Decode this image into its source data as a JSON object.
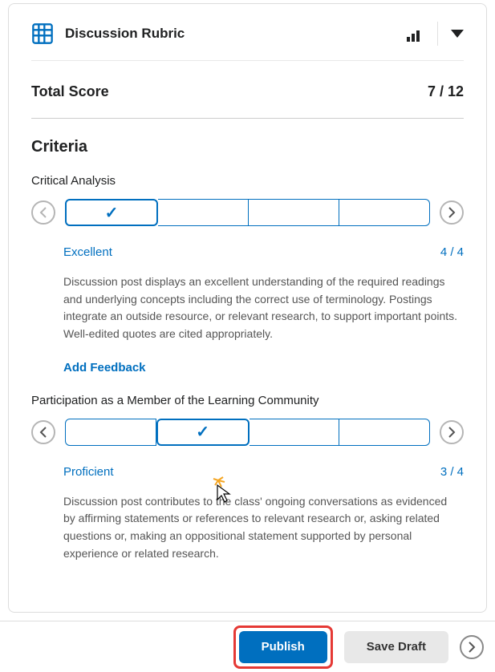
{
  "header": {
    "title": "Discussion Rubric"
  },
  "total": {
    "label": "Total Score",
    "value": "7 / 12"
  },
  "criteria": {
    "section_title": "Criteria",
    "items": [
      {
        "title": "Critical Analysis",
        "selected_index": 0,
        "level_label": "Excellent",
        "level_score": "4 / 4",
        "description": "Discussion post displays an excellent understanding of the required readings and underlying concepts including the correct use of terminology. Postings integrate an outside resource, or relevant research, to support important points. Well-edited quotes are cited appropriately.",
        "add_feedback": "Add Feedback"
      },
      {
        "title": "Participation as a Member of the Learning Community",
        "selected_index": 1,
        "level_label": "Proficient",
        "level_score": "3 / 4",
        "description": "Discussion post contributes to the class' ongoing conversations as evidenced by  affirming statements or references to relevant research or, asking related questions or, making an oppositional statement supported by personal experience or related research."
      }
    ]
  },
  "footer": {
    "publish": "Publish",
    "save_draft": "Save Draft"
  }
}
